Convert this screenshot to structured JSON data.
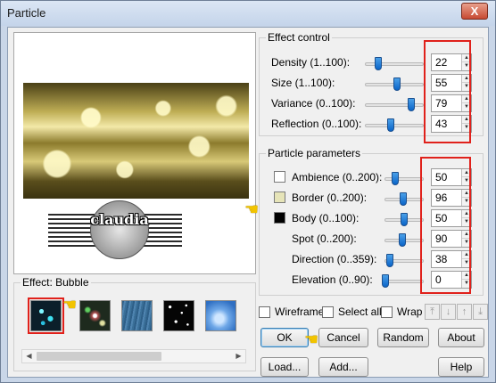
{
  "window": {
    "title": "Particle",
    "close_label": "X"
  },
  "preview": {
    "watermark_text": "claudia"
  },
  "effect_control": {
    "title": "Effect control",
    "rows": [
      {
        "label": "Density (1..100):",
        "value": "22"
      },
      {
        "label": "Size (1..100):",
        "value": "55"
      },
      {
        "label": "Variance (0..100):",
        "value": "79"
      },
      {
        "label": "Reflection (0..100):",
        "value": "43"
      }
    ]
  },
  "particle_parameters": {
    "title": "Particle parameters",
    "rows": [
      {
        "label": "Ambience (0..200):",
        "value": "50",
        "swatch": "#ffffff"
      },
      {
        "label": "Border (0..200):",
        "value": "96",
        "swatch": "#e6e4b8"
      },
      {
        "label": "Body (0..100):",
        "value": "50",
        "swatch": "#000000"
      },
      {
        "label": "Spot (0..200):",
        "value": "90"
      },
      {
        "label": "Direction (0..359):",
        "value": "38"
      },
      {
        "label": "Elevation (0..90):",
        "value": "0"
      }
    ]
  },
  "effects": {
    "label": "Effect: Bubble",
    "thumbnails": [
      "bubble",
      "lights",
      "rain",
      "stars",
      "clouds"
    ]
  },
  "options": {
    "wireframe": "Wireframe",
    "select_all": "Select all",
    "wrap": "Wrap"
  },
  "buttons": {
    "ok": "OK",
    "cancel": "Cancel",
    "random": "Random",
    "about": "About",
    "load": "Load...",
    "add": "Add...",
    "help": "Help"
  },
  "colors": {
    "highlight_red": "#e0211b",
    "slider_blue": "#0a64c8",
    "title_bg": "#c4d4ea"
  }
}
